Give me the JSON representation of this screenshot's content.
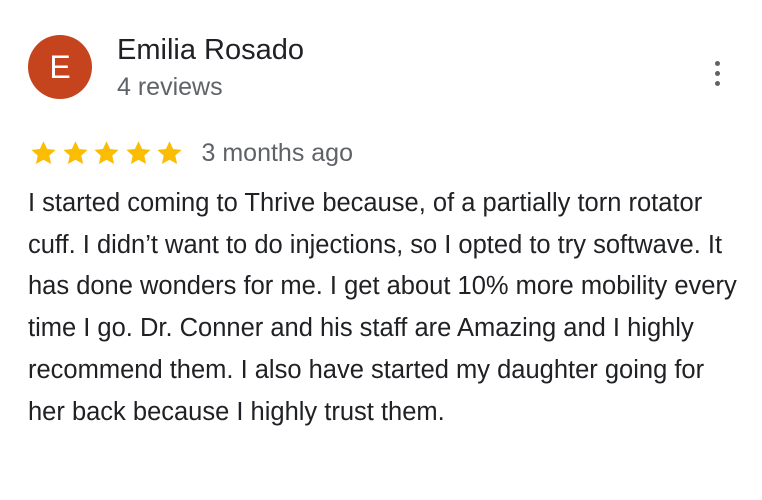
{
  "reviewer": {
    "initial": "E",
    "name": "Emilia Rosado",
    "review_count": "4 reviews",
    "avatar_color": "#c5441e"
  },
  "review": {
    "rating": 5,
    "max_rating": 5,
    "star_color": "#fbbc04",
    "date": "3 months ago",
    "text": "I started coming to Thrive because, of a partially torn rotator cuff. I didn’t want to do injections, so I opted to try softwave. It has done wonders for me. I get about 10% more mobility every time I go. Dr. Conner and his staff are Amazing and I highly recommend them. I also have started my daughter going for her back because I highly trust them."
  },
  "icons": {
    "menu": "more-vert-icon",
    "star": "star-icon"
  }
}
